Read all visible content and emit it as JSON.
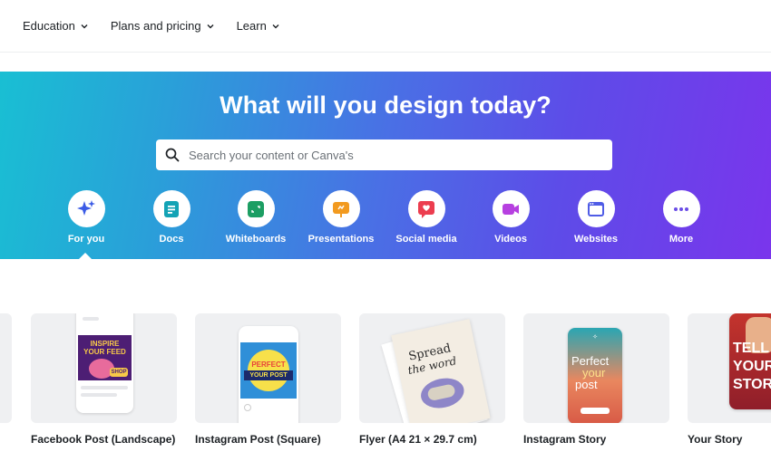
{
  "nav": {
    "items": [
      {
        "label": "Education"
      },
      {
        "label": "Plans and pricing"
      },
      {
        "label": "Learn"
      }
    ]
  },
  "hero": {
    "title": "What will you design today?",
    "search_placeholder": "Search your content or Canva's",
    "categories": [
      {
        "label": "For you",
        "icon": "sparkle-icon",
        "color": "#3b5be6",
        "active": true
      },
      {
        "label": "Docs",
        "icon": "docs-icon",
        "color": "#13a3b5"
      },
      {
        "label": "Whiteboards",
        "icon": "whiteboard-icon",
        "color": "#1c9e63"
      },
      {
        "label": "Presentations",
        "icon": "presentation-icon",
        "color": "#f29a1f"
      },
      {
        "label": "Social media",
        "icon": "heart-icon",
        "color": "#ec3d4f"
      },
      {
        "label": "Videos",
        "icon": "video-icon",
        "color": "#b640e0"
      },
      {
        "label": "Websites",
        "icon": "website-icon",
        "color": "#4f5ce6"
      },
      {
        "label": "More",
        "icon": "more-icon",
        "color": "#6a4de6"
      }
    ]
  },
  "cards": [
    {
      "title": "Facebook Post (Landscape)",
      "art_text_1": "INSPIRE",
      "art_text_2": "YOUR FEED",
      "art_text_3": "SHOP"
    },
    {
      "title": "Instagram Post (Square)",
      "art_text_1": "PERFECT",
      "art_text_2": "YOUR POST"
    },
    {
      "title": "Flyer (A4 21 × 29.7 cm)",
      "art_text_1": "Spread",
      "art_text_2": "the word"
    },
    {
      "title": "Instagram Story",
      "art_text_1": "Perfect",
      "art_text_2": "your",
      "art_text_3": "post"
    },
    {
      "title": "Your Story",
      "art_text_1": "TELL",
      "art_text_2": "YOUR",
      "art_text_3": "STORY"
    }
  ]
}
